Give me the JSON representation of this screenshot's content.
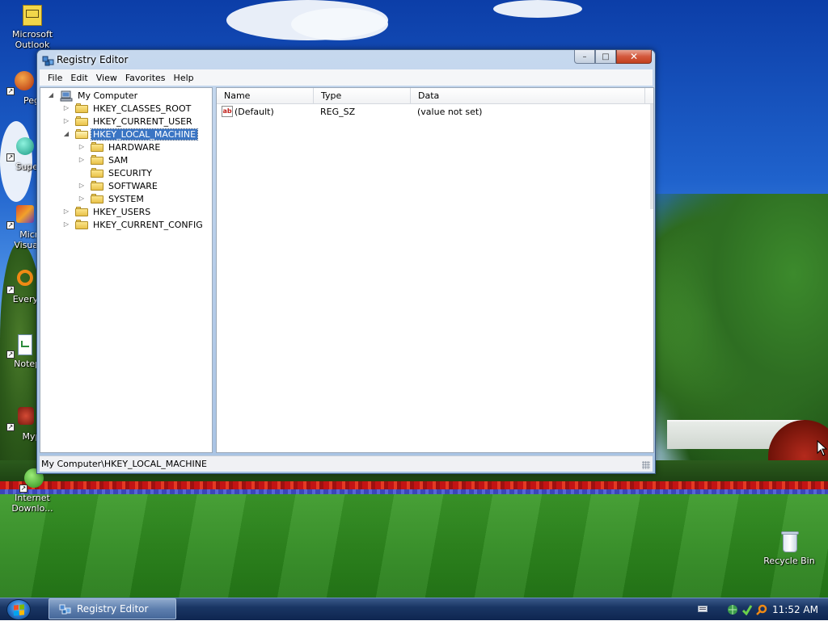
{
  "desktop": {
    "icons": [
      {
        "label": "Microsoft Outlook"
      },
      {
        "label": "Peg"
      },
      {
        "label": "Superi"
      },
      {
        "label": "Micro Visual S"
      },
      {
        "label": "Everyth"
      },
      {
        "label": "Notepa"
      },
      {
        "label": "Myp"
      },
      {
        "label": "Internet Downlo..."
      },
      {
        "label": "Recycle Bin"
      }
    ]
  },
  "window": {
    "title": "Registry Editor",
    "caption_buttons": {
      "minimize": "–",
      "maximize": "□",
      "close": "✕"
    },
    "menu": [
      "File",
      "Edit",
      "View",
      "Favorites",
      "Help"
    ],
    "tree": {
      "root": "My Computer",
      "nodes": [
        {
          "label": "HKEY_CLASSES_ROOT",
          "expander": "▷"
        },
        {
          "label": "HKEY_CURRENT_USER",
          "expander": "▷"
        },
        {
          "label": "HKEY_LOCAL_MACHINE",
          "expander": "◢",
          "selected": true
        },
        {
          "label": "HARDWARE",
          "expander": "▷"
        },
        {
          "label": "SAM",
          "expander": "▷"
        },
        {
          "label": "SECURITY",
          "expander": ""
        },
        {
          "label": "SOFTWARE",
          "expander": "▷"
        },
        {
          "label": "SYSTEM",
          "expander": "▷"
        },
        {
          "label": "HKEY_USERS",
          "expander": "▷"
        },
        {
          "label": "HKEY_CURRENT_CONFIG",
          "expander": "▷"
        }
      ]
    },
    "values": {
      "columns": [
        "Name",
        "Type",
        "Data"
      ],
      "rows": [
        {
          "name": "(Default)",
          "type": "REG_SZ",
          "data": "(value not set)"
        }
      ]
    },
    "status": "My Computer\\HKEY_LOCAL_MACHINE"
  },
  "taskbar": {
    "button": "Registry Editor",
    "clock": "11:52 AM"
  },
  "colors": {
    "selection": "#3a75c4",
    "folder": "#f3d56a",
    "taskbar": "#1a3664"
  }
}
